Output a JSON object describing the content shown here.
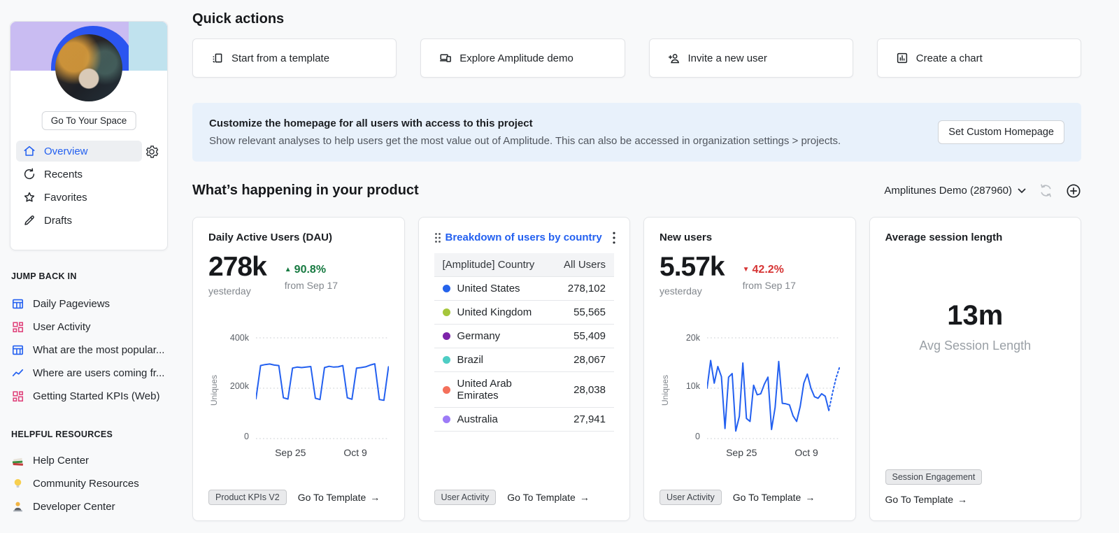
{
  "ui": {
    "arrow_glyph": "→",
    "triangle_up": "▲",
    "triangle_down": "▼"
  },
  "sidebar": {
    "profile": {
      "go_to_space_label": "Go To Your Space"
    },
    "nav": [
      {
        "label": "Overview",
        "icon": "home-icon",
        "active": true
      },
      {
        "label": "Recents",
        "icon": "recents-icon"
      },
      {
        "label": "Favorites",
        "icon": "star-icon"
      },
      {
        "label": "Drafts",
        "icon": "pencil-icon"
      }
    ],
    "sections": [
      {
        "heading": "JUMP BACK IN",
        "items": [
          {
            "label": "Daily Pageviews",
            "icon": "table-icon"
          },
          {
            "label": "User Activity",
            "icon": "dashboard-icon"
          },
          {
            "label": "What are the most popular...",
            "icon": "table-icon"
          },
          {
            "label": "Where are users coming fr...",
            "icon": "line-chart-icon"
          },
          {
            "label": "Getting Started KPIs (Web)",
            "icon": "dashboard-icon"
          }
        ]
      },
      {
        "heading": "HELPFUL RESOURCES",
        "items": [
          {
            "label": "Help Center",
            "icon": "books-icon"
          },
          {
            "label": "Community Resources",
            "icon": "bulb-icon"
          },
          {
            "label": "Developer Center",
            "icon": "developer-icon"
          }
        ]
      }
    ]
  },
  "quick_actions": {
    "title": "Quick actions",
    "buttons": [
      {
        "label": "Start from a template",
        "icon": "template-icon"
      },
      {
        "label": "Explore Amplitude demo",
        "icon": "demo-icon"
      },
      {
        "label": "Invite a new user",
        "icon": "invite-user-icon"
      },
      {
        "label": "Create a chart",
        "icon": "chart-icon"
      }
    ]
  },
  "banner": {
    "title": "Customize the homepage for all users with access to this project",
    "subtitle": "Show relevant analyses to help users get the most value out of Amplitude. This can also be accessed in organization settings > projects.",
    "button_label": "Set Custom Homepage"
  },
  "product_section": {
    "title": "What’s happening in your product",
    "project_selector": "Amplitunes Demo (287960)"
  },
  "cards": {
    "dau": {
      "title": "Daily Active Users (DAU)",
      "value": "278k",
      "value_caption": "yesterday",
      "delta": "90.8%",
      "delta_direction": "up",
      "delta_caption": "from Sep 17",
      "badge": "Product KPIs V2",
      "link_label": "Go To Template"
    },
    "country": {
      "title": "Breakdown of users by country",
      "columns": [
        "[Amplitude] Country",
        "All Users"
      ],
      "rows": [
        {
          "name": "United States",
          "value": "278,102",
          "color": "#2563eb"
        },
        {
          "name": "United Kingdom",
          "value": "55,565",
          "color": "#a5c63b"
        },
        {
          "name": "Germany",
          "value": "55,409",
          "color": "#7d24aa"
        },
        {
          "name": "Brazil",
          "value": "28,067",
          "color": "#4ecdc4"
        },
        {
          "name": "United Arab Emirates",
          "value": "28,038",
          "color": "#f4705b"
        },
        {
          "name": "Australia",
          "value": "27,941",
          "color": "#9d7bf7"
        }
      ],
      "badge": "User Activity",
      "link_label": "Go To Template"
    },
    "new_users": {
      "title": "New users",
      "value": "5.57k",
      "value_caption": "yesterday",
      "delta": "42.2%",
      "delta_direction": "down",
      "delta_caption": "from Sep 17",
      "badge": "User Activity",
      "link_label": "Go To Template"
    },
    "session": {
      "title": "Average session length",
      "value": "13m",
      "caption": "Avg Session Length",
      "badge": "Session Engagement",
      "link_label": "Go To Template"
    }
  },
  "chart_data": [
    {
      "id": "dau",
      "type": "line",
      "title": "Daily Active Users (DAU)",
      "ylabel": "Uniques",
      "unit": "thousands of users per day",
      "ylim_thousands": [
        0,
        400
      ],
      "ytick_labels": [
        "400k",
        "200k",
        "0"
      ],
      "xtick_labels": [
        "Sep 25",
        "Oct 9"
      ],
      "values_thousands": [
        158,
        290,
        294,
        296,
        292,
        290,
        162,
        157,
        280,
        284,
        282,
        284,
        286,
        160,
        155,
        282,
        287,
        284,
        285,
        290,
        162,
        156,
        280,
        282,
        285,
        292,
        297,
        155,
        152,
        285
      ]
    },
    {
      "id": "new_users",
      "type": "line",
      "title": "New users",
      "ylabel": "Uniques",
      "unit": "thousands of users per day",
      "ylim_thousands": [
        0,
        20
      ],
      "ytick_labels": [
        "20k",
        "10k",
        "0"
      ],
      "xtick_labels": [
        "Sep 25",
        "Oct 9"
      ],
      "values_thousands": [
        10,
        15.5,
        11,
        14.3,
        12.3,
        2,
        12.2,
        12.9,
        1.5,
        4.4,
        15,
        4,
        3.4,
        10.6,
        8.7,
        8.9,
        10.8,
        12.2,
        1.8,
        6.2,
        15.3,
        7,
        6.9,
        6.7,
        4.5,
        3.4,
        6.4,
        11,
        12.8,
        10,
        8.3,
        8,
        8.9,
        8.4,
        5.6
      ],
      "projected_thousands": [
        9,
        12,
        14.2
      ]
    },
    {
      "id": "country_breakdown",
      "type": "table",
      "title": "Breakdown of users by country",
      "columns": [
        "[Amplitude] Country",
        "All Users"
      ],
      "rows": [
        [
          "United States",
          278102
        ],
        [
          "United Kingdom",
          55565
        ],
        [
          "Germany",
          55409
        ],
        [
          "Brazil",
          28067
        ],
        [
          "United Arab Emirates",
          28038
        ],
        [
          "Australia",
          27941
        ]
      ]
    }
  ]
}
